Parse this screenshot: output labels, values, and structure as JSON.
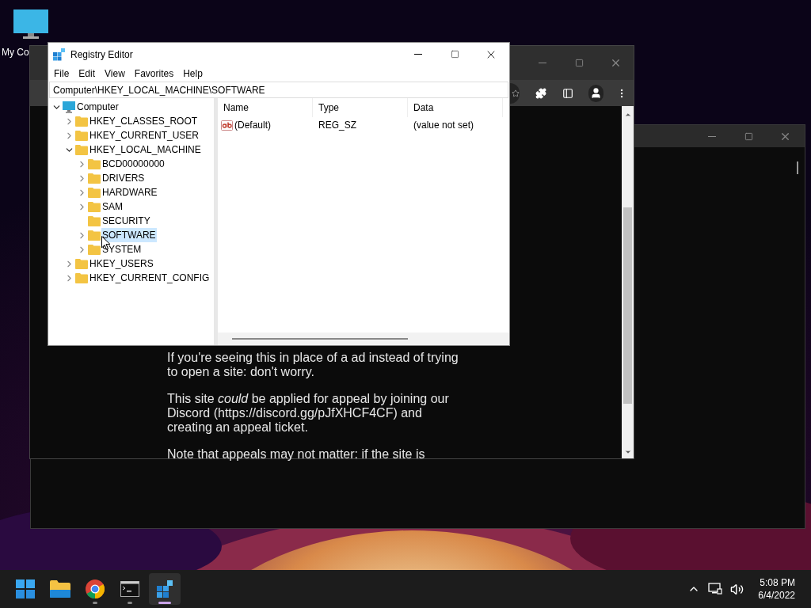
{
  "desktop": {
    "icons": [
      {
        "label": "My Co"
      }
    ]
  },
  "browser": {
    "paragraphs": [
      "If you're seeing this in place of a ad instead of trying to open a site: don't worry.",
      "This site *could* be applied for appeal by joining our Discord (https://discord.gg/pJfXHCF4CF) and creating an appeal ticket.",
      "Note that appeals may not matter: if the site is"
    ]
  },
  "registry_editor": {
    "title": "Registry Editor",
    "menu": [
      "File",
      "Edit",
      "View",
      "Favorites",
      "Help"
    ],
    "address": "Computer\\HKEY_LOCAL_MACHINE\\SOFTWARE",
    "tree": [
      {
        "label": "Computer",
        "kind": "computer",
        "expandable": true,
        "expanded": true,
        "selected": false,
        "children": [
          {
            "label": "HKEY_CLASSES_ROOT",
            "kind": "folder",
            "expandable": true,
            "expanded": false,
            "selected": false
          },
          {
            "label": "HKEY_CURRENT_USER",
            "kind": "folder",
            "expandable": true,
            "expanded": false,
            "selected": false
          },
          {
            "label": "HKEY_LOCAL_MACHINE",
            "kind": "folder",
            "expandable": true,
            "expanded": true,
            "selected": false,
            "children": [
              {
                "label": "BCD00000000",
                "kind": "folder",
                "expandable": true,
                "expanded": false,
                "selected": false
              },
              {
                "label": "DRIVERS",
                "kind": "folder",
                "expandable": true,
                "expanded": false,
                "selected": false
              },
              {
                "label": "HARDWARE",
                "kind": "folder",
                "expandable": true,
                "expanded": false,
                "selected": false
              },
              {
                "label": "SAM",
                "kind": "folder",
                "expandable": true,
                "expanded": false,
                "selected": false
              },
              {
                "label": "SECURITY",
                "kind": "folder",
                "expandable": false,
                "expanded": false,
                "selected": false
              },
              {
                "label": "SOFTWARE",
                "kind": "folder",
                "expandable": true,
                "expanded": false,
                "selected": true
              },
              {
                "label": "SYSTEM",
                "kind": "folder",
                "expandable": true,
                "expanded": false,
                "selected": false
              }
            ]
          },
          {
            "label": "HKEY_USERS",
            "kind": "folder",
            "expandable": true,
            "expanded": false,
            "selected": false
          },
          {
            "label": "HKEY_CURRENT_CONFIG",
            "kind": "folder",
            "expandable": true,
            "expanded": false,
            "selected": false
          }
        ]
      }
    ],
    "columns": [
      "Name",
      "Type",
      "Data"
    ],
    "values": [
      {
        "name": "(Default)",
        "type": "REG_SZ",
        "data": "(value not set)"
      }
    ]
  },
  "taskbar": {
    "apps": [
      {
        "kind": "start",
        "running": false,
        "selected": false
      },
      {
        "kind": "explorer",
        "running": false,
        "selected": false
      },
      {
        "kind": "chrome",
        "running": true,
        "selected": false
      },
      {
        "kind": "terminal",
        "running": true,
        "selected": false
      },
      {
        "kind": "regedit",
        "running": true,
        "selected": true
      }
    ],
    "time": "5:08 PM",
    "date": "6/4/2022"
  }
}
